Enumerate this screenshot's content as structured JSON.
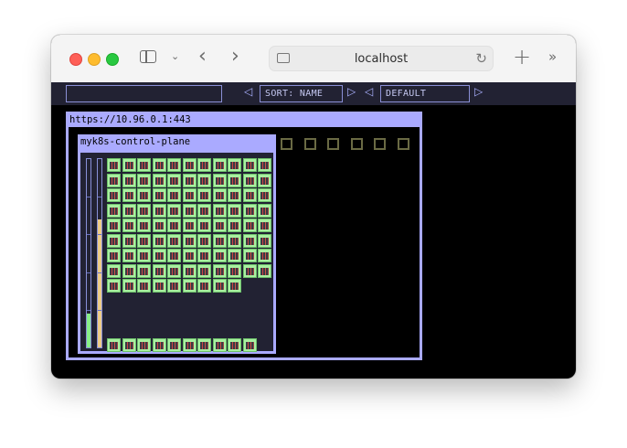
{
  "browser": {
    "url": "localhost"
  },
  "toolbar": {
    "search_value": "",
    "sort_label": "SORT: NAME",
    "theme_label": "DEFAULT"
  },
  "cluster": {
    "api_server": "https://10.96.0.1:443",
    "node": {
      "name": "myk8s-control-plane",
      "cpu_usage": 0.18,
      "memory_usage": 0.68,
      "pods_grid_count": 97,
      "pods_bottom_row_count": 10
    },
    "empty_node_slots": 6
  },
  "colors": {
    "cluster_border": "#aaaaff",
    "panel_bg": "#222233",
    "pod_ok": "#a8f0a0",
    "cpu_bar": "#88ee88",
    "memory_bar": "#eecc88"
  }
}
